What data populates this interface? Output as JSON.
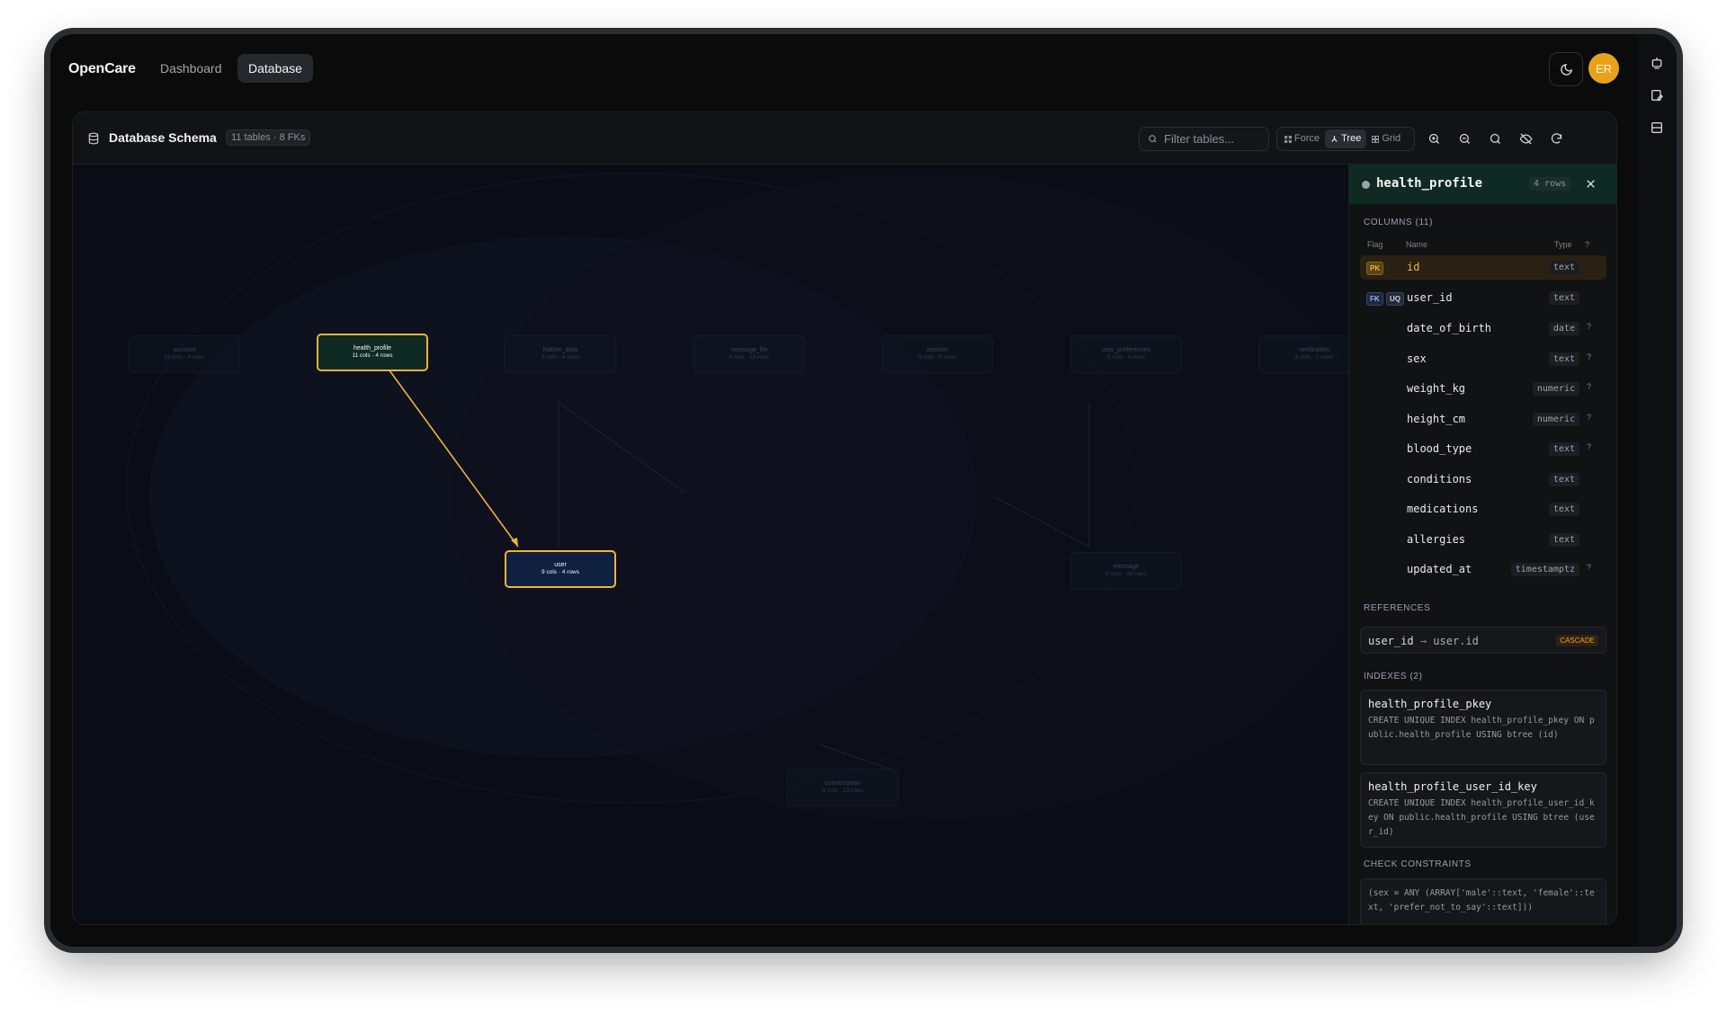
{
  "app": {
    "brand": "OpenCare",
    "nav": [
      {
        "label": "Dashboard",
        "active": false
      },
      {
        "label": "Database",
        "active": true
      }
    ],
    "avatar_initials": "ER",
    "accent_color": "#f0b23a"
  },
  "schema": {
    "title": "Database Schema",
    "summary": "11 tables · 8 FKs",
    "filter_placeholder": "Filter tables...",
    "layouts": [
      {
        "label": "Force",
        "active": false
      },
      {
        "label": "Tree",
        "active": true
      },
      {
        "label": "Grid",
        "active": false
      }
    ],
    "tools": [
      "zoom-in-icon",
      "zoom-out-icon",
      "zoom-fit-icon",
      "hide-icon",
      "refresh-icon"
    ]
  },
  "graph": {
    "nodes": [
      {
        "name": "account",
        "meta": "13 cols · 4 rows",
        "state": "dim"
      },
      {
        "name": "health_profile",
        "meta": "11 cols · 4 rows",
        "state": "selected"
      },
      {
        "name": "hidden_data",
        "meta": "3 cols · 4 rows",
        "state": "dim"
      },
      {
        "name": "message_file",
        "meta": "4 cols · 13 rows",
        "state": "dim"
      },
      {
        "name": "session",
        "meta": "8 cols · 5 rows",
        "state": "dim"
      },
      {
        "name": "user_preferences",
        "meta": "5 cols · 4 rows",
        "state": "dim"
      },
      {
        "name": "verification",
        "meta": "6 cols · 2 rows",
        "state": "dim"
      },
      {
        "name": "user",
        "meta": "9 cols · 4 rows",
        "state": "related"
      },
      {
        "name": "message",
        "meta": "5 cols · 42 rows",
        "state": "dim"
      },
      {
        "name": "conversation",
        "meta": "5 cols · 13 rows",
        "state": "dim"
      }
    ]
  },
  "detail": {
    "table_name": "health_profile",
    "rows_badge": "4 rows",
    "columns_heading": "COLUMNS (11)",
    "col_headers": {
      "flag": "Flag",
      "name": "Name",
      "type": "Type",
      "q": "?"
    },
    "columns": [
      {
        "flags": [
          "PK"
        ],
        "name": "id",
        "type": "text",
        "nullable": ""
      },
      {
        "flags": [
          "FK",
          "UQ"
        ],
        "name": "user_id",
        "type": "text",
        "nullable": ""
      },
      {
        "flags": [],
        "name": "date_of_birth",
        "type": "date",
        "nullable": "?"
      },
      {
        "flags": [],
        "name": "sex",
        "type": "text",
        "nullable": "?"
      },
      {
        "flags": [],
        "name": "weight_kg",
        "type": "numeric",
        "nullable": "?"
      },
      {
        "flags": [],
        "name": "height_cm",
        "type": "numeric",
        "nullable": "?"
      },
      {
        "flags": [],
        "name": "blood_type",
        "type": "text",
        "nullable": "?"
      },
      {
        "flags": [],
        "name": "conditions",
        "type": "text",
        "nullable": ""
      },
      {
        "flags": [],
        "name": "medications",
        "type": "text",
        "nullable": ""
      },
      {
        "flags": [],
        "name": "allergies",
        "type": "text",
        "nullable": ""
      },
      {
        "flags": [],
        "name": "updated_at",
        "type": "timestamptz",
        "nullable": "?"
      }
    ],
    "references_heading": "REFERENCES",
    "reference": {
      "from": "user_id",
      "arrow": "→",
      "to": "user.id",
      "action": "CASCADE"
    },
    "indexes_heading": "INDEXES (2)",
    "indexes": [
      {
        "name": "health_profile_pkey",
        "def": "CREATE UNIQUE INDEX health_profile_pkey ON public.health_profile USING btree (id)"
      },
      {
        "name": "health_profile_user_id_key",
        "def": "CREATE UNIQUE INDEX health_profile_user_id_key ON public.health_profile USING btree (user_id)"
      }
    ],
    "check_heading": "CHECK CONSTRAINTS",
    "check_constraint": "(sex = ANY (ARRAY['male'::text, 'female'::text, 'prefer_not_to_say'::text]))"
  }
}
